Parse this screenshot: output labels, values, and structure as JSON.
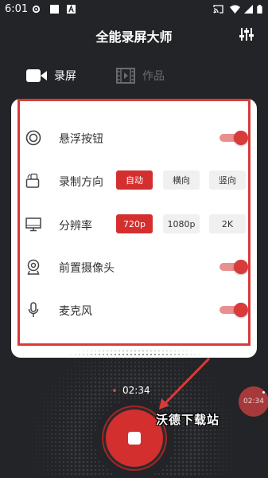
{
  "status_bar": {
    "time": "6:01",
    "left_icons": [
      "gear-icon",
      "image-icon",
      "font-icon"
    ],
    "right_icons": [
      "cast-icon",
      "wifi-icon",
      "signal-icon",
      "battery-icon"
    ]
  },
  "header": {
    "title": "全能录屏大师",
    "settings_icon": "sliders-icon"
  },
  "tabs": [
    {
      "label": "录屏",
      "icon": "video-camera-icon",
      "active": true
    },
    {
      "label": "作品",
      "icon": "film-icon",
      "active": false
    }
  ],
  "settings": {
    "floating_button": {
      "label": "悬浮按钮",
      "icon": "target-icon",
      "enabled": true
    },
    "orientation": {
      "label": "录制方向",
      "icon": "rotate-screen-icon",
      "options": [
        "自动",
        "横向",
        "竖向"
      ],
      "selected": "自动"
    },
    "resolution": {
      "label": "分辨率",
      "icon": "monitor-icon",
      "options": [
        "720p",
        "1080p",
        "2K"
      ],
      "selected": "720p"
    },
    "front_camera": {
      "label": "前置摄像头",
      "icon": "webcam-icon",
      "enabled": true
    },
    "microphone": {
      "label": "麦克风",
      "icon": "microphone-icon",
      "enabled": true
    }
  },
  "recorder": {
    "elapsed": "02:34",
    "side_elapsed": "02:34"
  },
  "watermark": "沃德下载站",
  "colors": {
    "background": "#232427",
    "accent": "#d32f2f",
    "highlight_border": "#d93a3a",
    "card": "#ffffff"
  }
}
